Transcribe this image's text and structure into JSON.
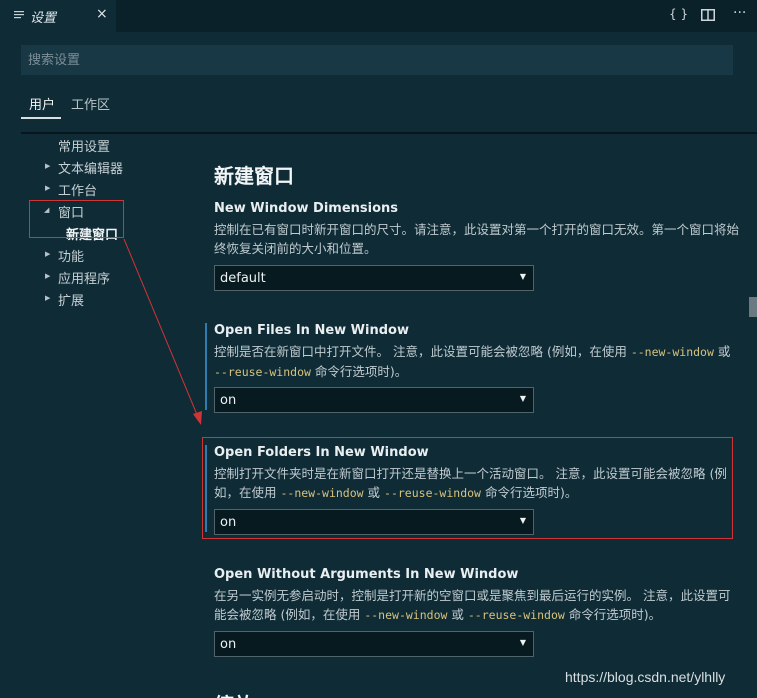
{
  "tab": {
    "icon": "settings-lines-icon",
    "title": "设置",
    "close": "×"
  },
  "toolbar": {
    "json_icon": "{ }",
    "split_icon": "split-editor-icon",
    "more_icon": "···"
  },
  "search": {
    "placeholder": "搜索设置"
  },
  "scopes": {
    "user": "用户",
    "workspace": "工作区"
  },
  "tree": {
    "common": "常用设置",
    "text_editor": "文本编辑器",
    "workbench": "工作台",
    "window": "窗口",
    "new_window": "新建窗口",
    "features": "功能",
    "application": "应用程序",
    "extensions": "扩展"
  },
  "main": {
    "section_title": "新建窗口",
    "settings": [
      {
        "title": "New Window Dimensions",
        "desc": "控制在已有窗口时新开窗口的尺寸。请注意，此设置对第一个打开的窗口无效。第一个窗口将始终恢复关闭前的大小和位置。",
        "value": "default"
      },
      {
        "title": "Open Files In New Window",
        "desc_pre": "控制是否在新窗口中打开文件。 注意，此设置可能会被忽略 (例如，在使用 ",
        "code1": "--new-window",
        "desc_mid": " 或 ",
        "code2": "--reuse-window",
        "desc_post": " 命令行选项时)。",
        "value": "on"
      },
      {
        "title": "Open Folders In New Window",
        "desc_pre": "控制打开文件夹时是在新窗口打开还是替换上一个活动窗口。 注意，此设置可能会被忽略 (例如，在使用 ",
        "code1": "--new-window",
        "desc_mid": " 或 ",
        "code2": "--reuse-window",
        "desc_post": " 命令行选项时)。",
        "value": "on"
      },
      {
        "title": "Open Without Arguments In New Window",
        "desc_pre": "在另一实例无参启动时，控制是打开新的空窗口或是聚焦到最后运行的实例。 注意，此设置可能会被忽略 (例如，在使用 ",
        "code1": "--new-window",
        "desc_mid": " 或 ",
        "code2": "--reuse-window",
        "desc_post": " 命令行选项时)。",
        "value": "on"
      }
    ],
    "next_section_partial": "缩放"
  },
  "watermark": "https://blog.csdn.net/ylhlly",
  "colors": {
    "background": "#0f2b36",
    "annotation_red": "#d03535",
    "modified_indicator": "#2f7cb0",
    "code_text": "#d7c27d"
  }
}
